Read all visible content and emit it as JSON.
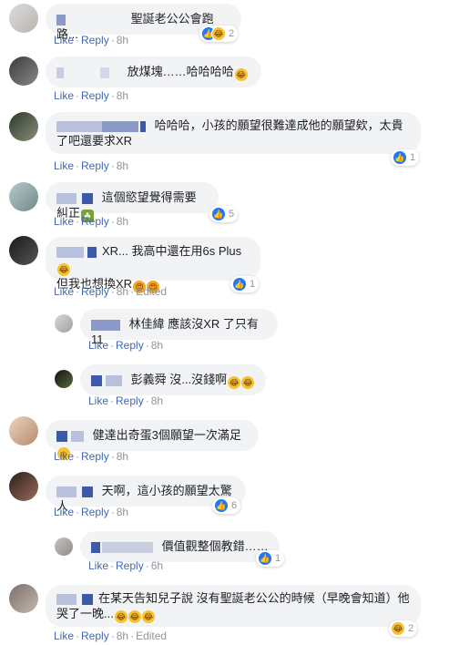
{
  "actions": {
    "like": "Like",
    "reply": "Reply",
    "sep": "·",
    "edited": "Edited"
  },
  "comments": [
    {
      "text": "聖誕老公公會跑路...",
      "time": "8h",
      "reactions": "2"
    },
    {
      "text": "放煤塊……哈哈哈哈",
      "time": "8h"
    },
    {
      "text": "哈哈哈，小孩的願望很難達成他的願望欸，太貴了吧還要求XR",
      "time": "8h",
      "reactions": "1"
    },
    {
      "text": "這個慾望覺得需要糾正",
      "time": "8h",
      "reactions": "5"
    },
    {
      "text": "XR... 我高中還在用6s Plus",
      "text2": "但我也想換XR",
      "time": "8h",
      "reactions": "1"
    },
    {
      "text": "林佳緯 應該沒XR 了只有11",
      "time": "8h"
    },
    {
      "text": "彭義舜 沒...沒錢啊",
      "time": "8h"
    },
    {
      "text": "健達出奇蛋3個願望一次滿足",
      "time": "8h"
    },
    {
      "text": "天啊，這小孩的願望太驚人",
      "time": "8h",
      "reactions": "6"
    },
    {
      "text": "價值觀整個教錯……",
      "time": "6h",
      "reactions": "1"
    },
    {
      "text": "在某天告知兒子說 沒有聖誕老公公的時候（早晚會知道）他",
      "text2": "哭了一晚...",
      "time": "8h",
      "reactions": "2"
    }
  ]
}
